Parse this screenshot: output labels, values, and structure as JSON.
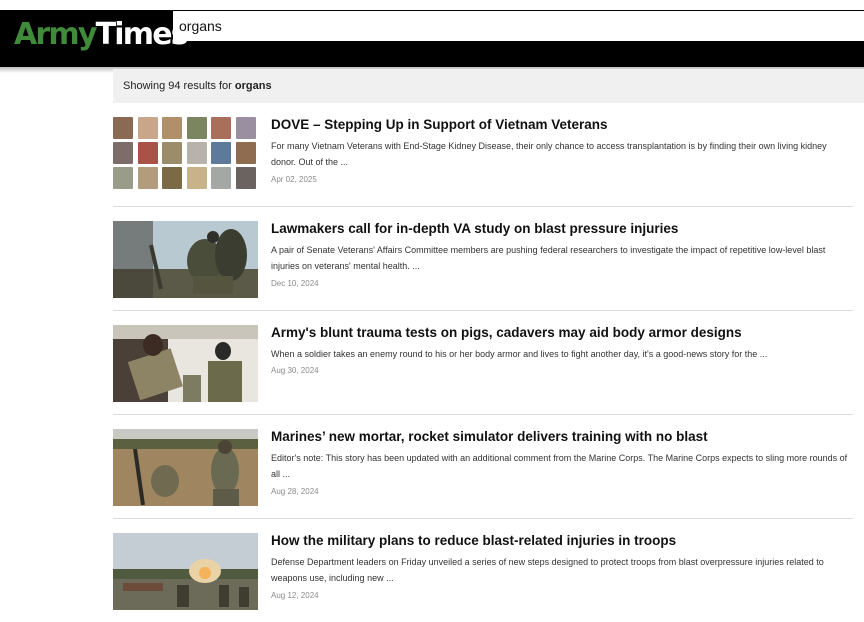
{
  "header": {
    "logo_part1": "Army",
    "logo_part2": "Times",
    "search_value": "organs"
  },
  "results_summary": {
    "prefix": "Showing 94 results for",
    "query": "organs"
  },
  "articles": [
    {
      "title": "DOVE – Stepping Up in Support of Vietnam Veterans",
      "description": "For many Vietnam Veterans with End-Stage Kidney Disease, their only chance to access transplantation is by finding their own living kidney donor. Out of the ...",
      "date": "Apr 02, 2025",
      "image": "veteran-portrait-mosaic"
    },
    {
      "title": "Lawmakers call for in-depth VA study on blast pressure injuries",
      "description": "A pair of Senate Veterans' Affairs Committee members are pushing federal researchers to investigate the impact of repetitive low-level blast injuries on veterans' mental health. ...",
      "date": "Dec 10, 2024",
      "image": "mortar-firing-photo"
    },
    {
      "title": "Army's blunt trauma tests on pigs, cadavers may aid body armor designs",
      "description": "When a soldier takes an enemy round to his or her body armor and lives to fight another day, it's a good-news story for the ...",
      "date": "Aug 30, 2024",
      "image": "body-armor-lab-photo"
    },
    {
      "title": "Marines’ new mortar, rocket simulator delivers training with no blast",
      "description": "Editor's note: This story has been updated with an additional comment from the Marine Corps. The Marine Corps expects to sling more rounds of all ...",
      "date": "Aug 28, 2024",
      "image": "marines-field-photo"
    },
    {
      "title": "How the military plans to reduce blast-related injuries in troops",
      "description": "Defense Department leaders on Friday unveiled a series of new steps designed to protect troops from blast overpressure injuries related to weapons use, including new ...",
      "date": "Aug 12, 2024",
      "image": "artillery-blast-photo"
    }
  ],
  "colors": {
    "topbar": "#000000",
    "logo_green": "#3f8b3a",
    "results_bar_bg": "#f0f0f0"
  }
}
